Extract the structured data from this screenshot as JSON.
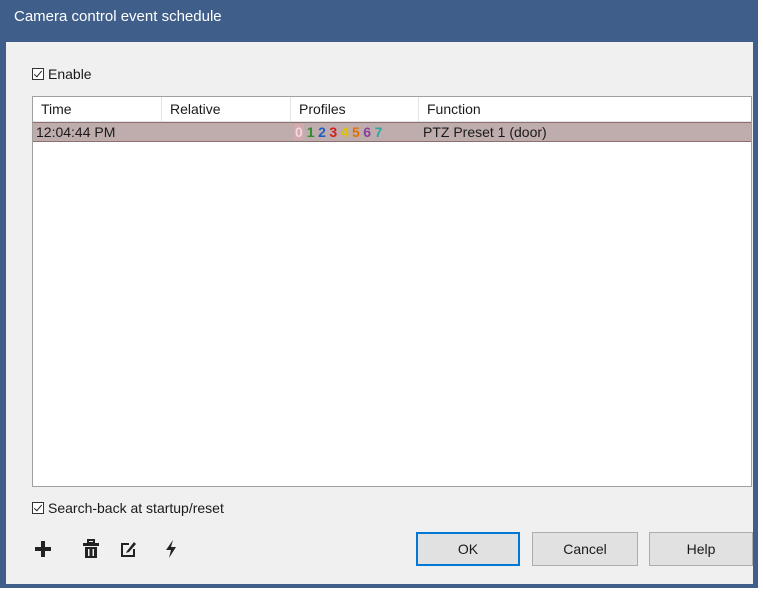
{
  "title": "Camera control event schedule",
  "enable": {
    "label": "Enable",
    "checked": true
  },
  "table": {
    "columns": [
      "Time",
      "Relative",
      "Profiles",
      "Function"
    ],
    "rows": [
      {
        "time": "12:04:44 PM",
        "relative": "",
        "profiles": [
          {
            "n": "0",
            "color": "#f1d9dc"
          },
          {
            "n": "1",
            "color": "#2e8b2e"
          },
          {
            "n": "2",
            "color": "#1f5fbf"
          },
          {
            "n": "3",
            "color": "#d02020"
          },
          {
            "n": "4",
            "color": "#e0c000"
          },
          {
            "n": "5",
            "color": "#e07000"
          },
          {
            "n": "6",
            "color": "#8a3fa0"
          },
          {
            "n": "7",
            "color": "#2aa7a7"
          }
        ],
        "function": "PTZ Preset  1 (door)"
      }
    ]
  },
  "search_back": {
    "label": "Search-back at startup/reset",
    "checked": true
  },
  "toolbar_icons": [
    "add-icon",
    "delete-icon",
    "edit-icon",
    "trigger-icon"
  ],
  "buttons": {
    "ok": "OK",
    "cancel": "Cancel",
    "help": "Help"
  }
}
